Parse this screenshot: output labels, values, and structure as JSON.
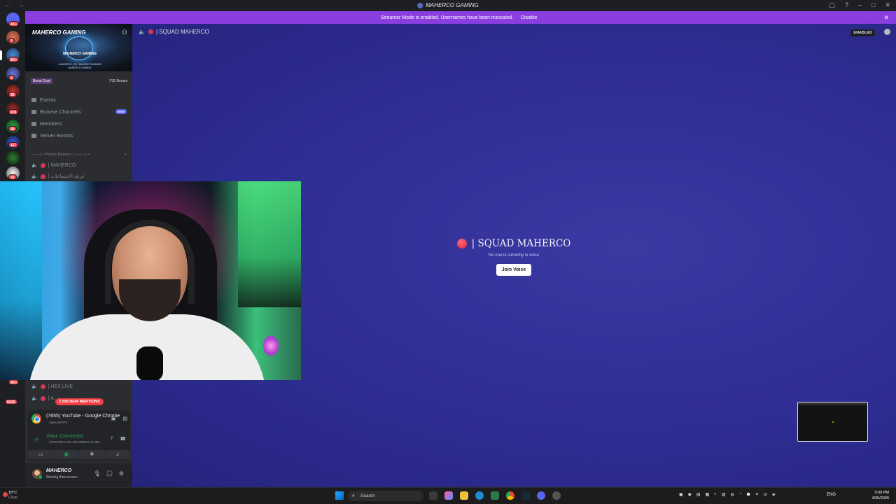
{
  "titlebar": {
    "title": "MAHERCO GAMING"
  },
  "banner": {
    "text": "Streamer Mode is enabled. Usernames have been truncated.",
    "disable_label": "Disable"
  },
  "rail": {
    "badges": [
      "1K+",
      "2",
      "2K+",
      "4",
      "28",
      "678",
      "98",
      "167",
      "33",
      "9K+",
      "NEW"
    ]
  },
  "sidebar": {
    "server_name": "MAHERCO GAMING",
    "banner_logo_text": "MAHERCO GAMING",
    "banner_handles": "/ MAHERCO_HD  / MAHERCOGAMING",
    "banner_handles2": "MAHERCO GAMING",
    "boost_goal": "Boost Goal",
    "boost_count": "7/36 Boosts",
    "items": [
      {
        "label": "Events"
      },
      {
        "label": "Browse Channels"
      },
      {
        "label": "Members"
      },
      {
        "label": "Server Boosts"
      }
    ],
    "new_tag": "NEW",
    "category": "—— | • Private Rooms • | —— < <",
    "channels": [
      {
        "label": "| MAHERCO"
      },
      {
        "label": "| غرفة الاجتماعات"
      },
      {
        "label": "| HEX LIVE"
      },
      {
        "label": "| A... "
      }
    ],
    "mentions": "2,558 NEW MENTIONS"
  },
  "activity": {
    "app_title": "(7655) YouTube - Google Chrome",
    "app_sub": "Video 60FPS",
    "voice_status": "Voice Connected",
    "voice_sub": "| PRIVATE LIVE / MAHERCO GAMI...",
    "controls": [
      "video",
      "screen",
      "activities",
      "soundboard"
    ]
  },
  "user": {
    "name": "MAHERCO",
    "status": "Sharing their screen"
  },
  "main": {
    "channel_name": "| SQUAD MAHERCO",
    "streamer_badge": "ENABLED",
    "voice_title": "| SQUAD MAHERCO",
    "no_one": "No one is currently in voice",
    "join_label": "Join Voice"
  },
  "taskbar": {
    "temp": "18°C",
    "weather": "Clear",
    "search_placeholder": "Search",
    "lang": "ENG",
    "time": "9:00 PM",
    "date": "4/30/2026"
  },
  "colors": {
    "accent": "#5865f2",
    "banner": "#8a3ee0",
    "voice_green": "#23a55a",
    "mention_red": "#f23f43"
  }
}
